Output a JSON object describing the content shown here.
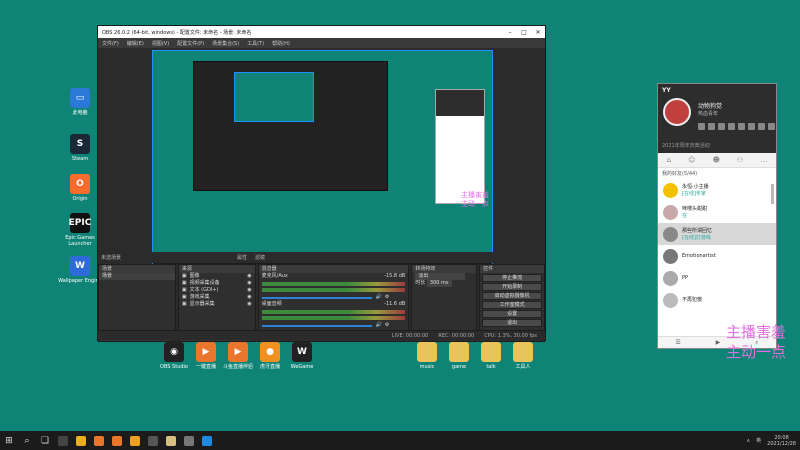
{
  "desktop": {
    "left_icons": [
      {
        "label": "此电脑",
        "glyph": "▭",
        "color": "#2b79d6"
      },
      {
        "label": "Steam",
        "glyph": "S",
        "color": "#1b2838"
      },
      {
        "label": "Origin",
        "glyph": "O",
        "color": "#f56c2d"
      },
      {
        "label": "Epic Games Launcher",
        "glyph": "EPIC",
        "color": "#111111"
      },
      {
        "label": "Wallpaper Engine",
        "glyph": "W",
        "color": "#2e6bd9"
      }
    ],
    "bottom_icons": [
      {
        "label": "OBS Studio",
        "glyph": "◉",
        "color": "#222222"
      },
      {
        "label": "一键直播",
        "glyph": "▶",
        "color": "#e8762c"
      },
      {
        "label": "斗鱼直播伴侣",
        "glyph": "▶",
        "color": "#e8762c"
      },
      {
        "label": "虎牙直播",
        "glyph": "●",
        "color": "#f09020"
      },
      {
        "label": "WeGame",
        "glyph": "W",
        "color": "#222222"
      }
    ],
    "folder_icons": [
      {
        "label": "music"
      },
      {
        "label": "game"
      },
      {
        "label": "talk"
      },
      {
        "label": "工具人"
      }
    ]
  },
  "obs": {
    "title": "OBS 26.0.2 (64-bit, windows) - 配置文件: 未命名 - 场景: 未命名",
    "menu": [
      "文件(F)",
      "编辑(E)",
      "视图(V)",
      "配置文件(P)",
      "场景集合(S)",
      "工具(T)",
      "帮助(H)"
    ],
    "docks": {
      "scenes": {
        "title": "场景",
        "items": [
          "场景"
        ],
        "selected": 0
      },
      "sources": {
        "title": "来源",
        "items": [
          "图像",
          "视频采集设备",
          "文本 (GDI+)",
          "游戏采集",
          "显示器采集"
        ]
      },
      "mixer": {
        "title": "混音器",
        "tracks": [
          {
            "name": "麦克风/Aux",
            "level": "-15.8 dB"
          },
          {
            "name": "桌面音频",
            "level": "-11.6 dB"
          }
        ]
      },
      "transitions": {
        "title": "转场特效",
        "type": "淡出",
        "duration_label": "时长",
        "duration": "300 ms"
      },
      "controls": {
        "title": "控件",
        "buttons": [
          "停止推流",
          "开始录制",
          "启动虚拟摄像机",
          "工作室模式",
          "设置",
          "退出"
        ]
      }
    },
    "sub_labels": {
      "no_source": "未选场景",
      "filter": "滤镜",
      "properties": "属性"
    },
    "status": {
      "live": "LIVE: 00:00:00",
      "rec": "REC: 00:00:00",
      "cpu": "CPU: 1.3%, 30.00 fps"
    }
  },
  "yy": {
    "logo": "YY",
    "username": "动物狗觉",
    "subtitle": "热血青年",
    "note": "2021年周年庆典活动",
    "group": "我的好友(5/44)",
    "contacts": [
      {
        "name": "永恒·小主播",
        "status": "[在线]专家"
      },
      {
        "name": "咪嗖头甜甜",
        "status": "在"
      },
      {
        "name": "那些所谓回忆",
        "status": "[在线]打游戏"
      },
      {
        "name": "Emotionartist",
        "status": ""
      },
      {
        "name": "PP",
        "status": ""
      },
      {
        "name": "不再犯傻",
        "status": ""
      }
    ],
    "selected_contact": 2
  },
  "overlay": {
    "line1": "主播害羞",
    "line2": "主动一点",
    "color": "#e070e0"
  },
  "taskbar": {
    "time": "20:08",
    "date": "2021/12/28",
    "lang": "英",
    "apps_colors": [
      "#444444",
      "#e8b020",
      "#e8762c",
      "#e8762c",
      "#f0a020",
      "#555555",
      "#d8c080",
      "#777777",
      "#1e88e5"
    ]
  }
}
